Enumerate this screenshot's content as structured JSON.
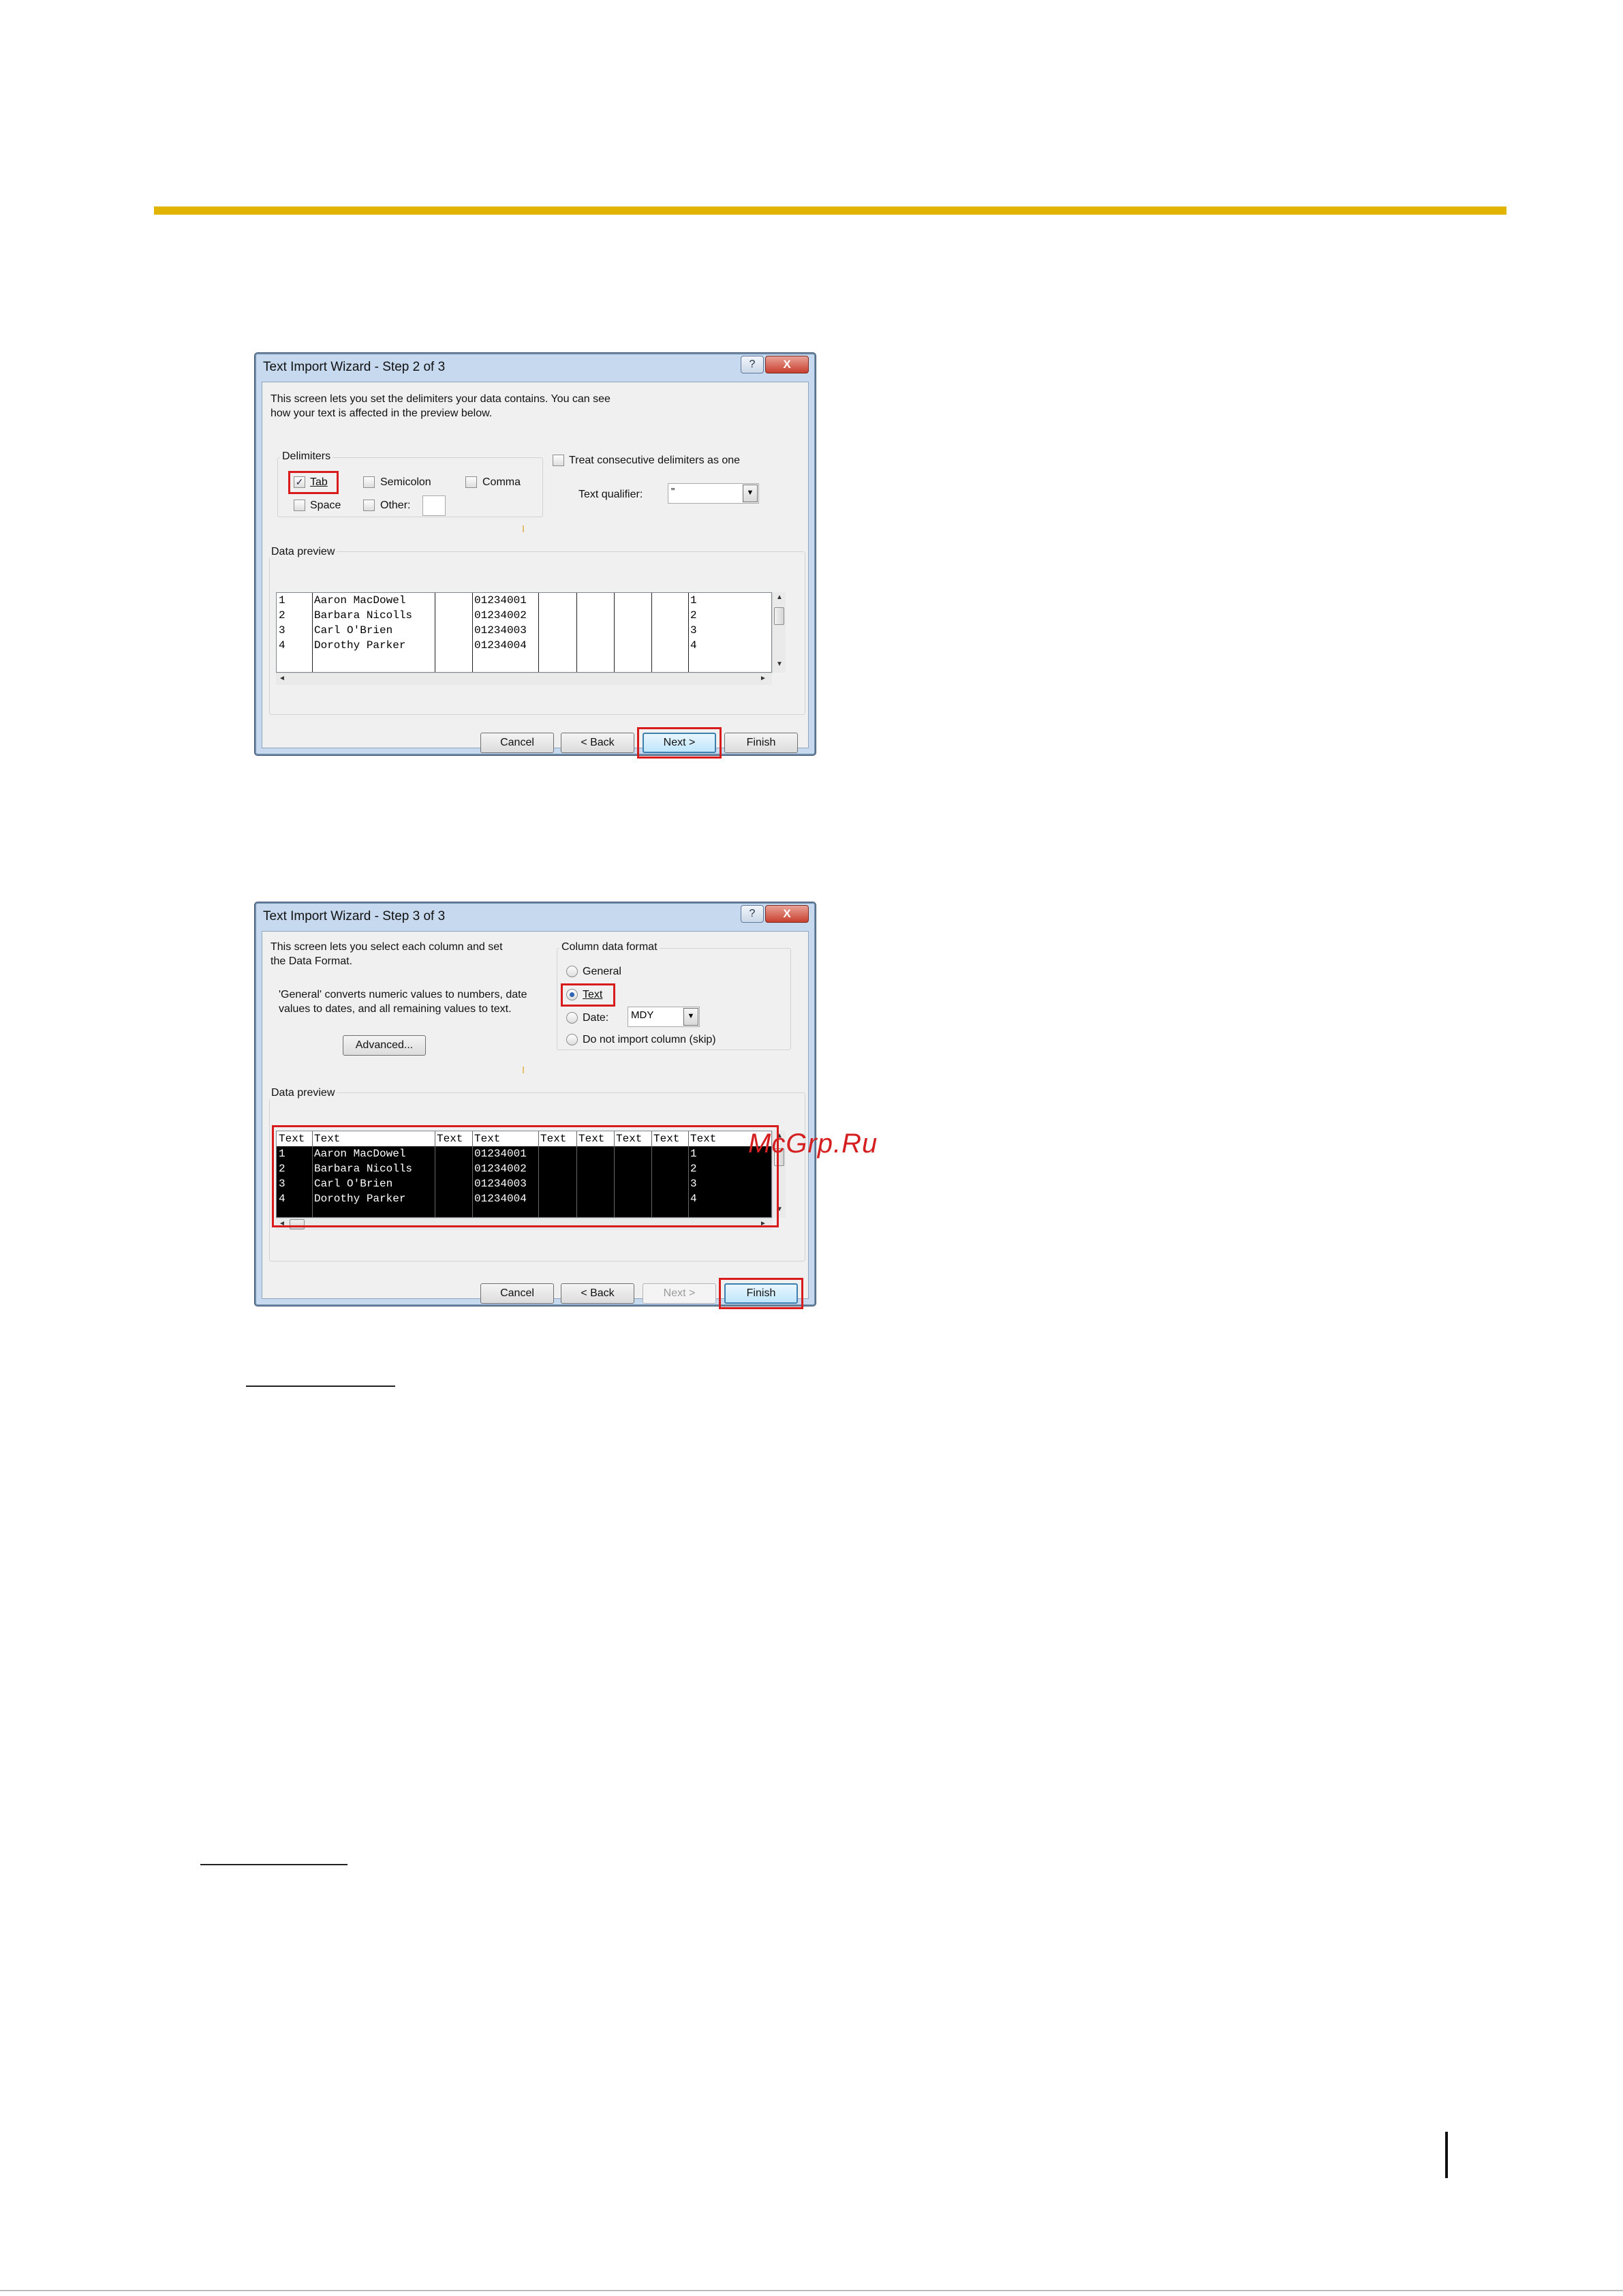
{
  "watermark": "McGrp.Ru",
  "dialog1": {
    "title": "Text Import Wizard - Step 2 of 3",
    "help_glyph": "?",
    "close_glyph": "X",
    "intro_line1": "This screen lets you set the delimiters your data contains.  You can see",
    "intro_line2": "how your text is affected in the preview below.",
    "delimiters_label": "Delimiters",
    "tab_label": "Tab",
    "tab_checked": true,
    "semicolon_label": "Semicolon",
    "comma_label": "Comma",
    "space_label": "Space",
    "other_label": "Other:",
    "consecutive_label": "Treat consecutive delimiters as one",
    "qualifier_label": "Text qualifier:",
    "qualifier_value": "\"",
    "preview_label": "Data preview",
    "rows": [
      [
        "1",
        "Aaron MacDowel",
        "",
        "01234001",
        "",
        "",
        "",
        "",
        "1"
      ],
      [
        "2",
        "Barbara Nicolls",
        "",
        "01234002",
        "",
        "",
        "",
        "",
        "2"
      ],
      [
        "3",
        "Carl O'Brien",
        "",
        "01234003",
        "",
        "",
        "",
        "",
        "3"
      ],
      [
        "4",
        "Dorothy Parker",
        "",
        "01234004",
        "",
        "",
        "",
        "",
        "4"
      ]
    ],
    "buttons": {
      "cancel": "Cancel",
      "back": "< Back",
      "next": "Next >",
      "finish": "Finish"
    }
  },
  "dialog2": {
    "title": "Text Import Wizard - Step 3 of 3",
    "help_glyph": "?",
    "close_glyph": "X",
    "intro_line1": "This screen lets you select each column and set",
    "intro_line2": "the Data Format.",
    "general_note_line1": "'General' converts numeric values to numbers, date",
    "general_note_line2": "values to dates, and all remaining values to text.",
    "advanced_button": "Advanced...",
    "format_group_label": "Column data format",
    "format_options": {
      "general": "General",
      "text": "Text",
      "date": "Date:",
      "skip": "Do not import column (skip)"
    },
    "selected_format": "Text",
    "date_value": "MDY",
    "preview_label": "Data preview",
    "headers": [
      "Text",
      "Text",
      "Text",
      "Text",
      "Text",
      "Text",
      "Text",
      "Text",
      "Text"
    ],
    "rows": [
      [
        "1",
        "Aaron MacDowel",
        "",
        "01234001",
        "",
        "",
        "",
        "",
        "1"
      ],
      [
        "2",
        "Barbara Nicolls",
        "",
        "01234002",
        "",
        "",
        "",
        "",
        "2"
      ],
      [
        "3",
        "Carl O'Brien",
        "",
        "01234003",
        "",
        "",
        "",
        "",
        "3"
      ],
      [
        "4",
        "Dorothy Parker",
        "",
        "01234004",
        "",
        "",
        "",
        "",
        "4"
      ]
    ],
    "buttons": {
      "cancel": "Cancel",
      "back": "< Back",
      "next": "Next >",
      "finish": "Finish"
    }
  }
}
